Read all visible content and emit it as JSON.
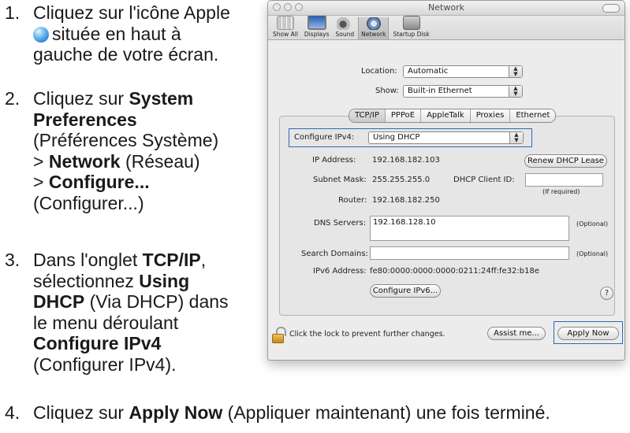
{
  "instructions": {
    "step1": {
      "num": "1.",
      "line1": "Cliquez sur l'icône Apple",
      "line2": "située en haut à",
      "line3": "gauche de votre écran."
    },
    "step2": {
      "num": "2.",
      "line1": "Cliquez sur",
      "bold1": "System",
      "line2": "Preferences",
      "line3": "(Préférences Système)",
      "line4_pre": ">",
      "line4_bold": "Network",
      "line4_post": "(Réseau)",
      "line5_pre": ">",
      "line5_bold": "Configure...",
      "line6": "(Configurer...)"
    },
    "step3": {
      "num": "3.",
      "line1_pre": "Dans l'onglet",
      "line1_bold": "TCP/IP",
      "line1_post": ",",
      "line2_pre": "sélectionnez",
      "line2_bold": "Using",
      "line3_bold": "DHCP",
      "line3_post": "(Via DHCP) dans",
      "line4": "le menu déroulant",
      "line5_bold": "Configure IPv4",
      "line6": "(Configurer IPv4)."
    },
    "step4": {
      "num": "4.",
      "pre": "Cliquez sur",
      "bold": "Apply Now",
      "post": "(Appliquer maintenant) une fois terminé."
    }
  },
  "window": {
    "title": "Network",
    "toolbar": [
      "Show All",
      "Displays",
      "Sound",
      "Network",
      "Startup Disk"
    ],
    "location_label": "Location:",
    "location_value": "Automatic",
    "show_label": "Show:",
    "show_value": "Built-in Ethernet",
    "tabs": [
      "TCP/IP",
      "PPPoE",
      "AppleTalk",
      "Proxies",
      "Ethernet"
    ],
    "configure_label": "Configure IPv4:",
    "configure_value": "Using DHCP",
    "ip_label": "IP Address:",
    "ip_value": "192.168.182.103",
    "renew_button": "Renew DHCP Lease",
    "subnet_label": "Subnet Mask:",
    "subnet_value": "255.255.255.0",
    "client_id_label": "DHCP Client ID:",
    "if_required": "(If required)",
    "router_label": "Router:",
    "router_value": "192.168.182.250",
    "dns_label": "DNS Servers:",
    "dns_value": "192.168.128.10",
    "optional": "(Optional)",
    "search_label": "Search Domains:",
    "ipv6_label": "IPv6 Address:",
    "ipv6_value": "fe80:0000:0000:0000:0211:24ff:fe32:b18e",
    "configure_ipv6_button": "Configure IPv6...",
    "help": "?",
    "lock_text": "Click the lock to prevent further changes.",
    "assist_button": "Assist me...",
    "apply_button": "Apply Now"
  }
}
